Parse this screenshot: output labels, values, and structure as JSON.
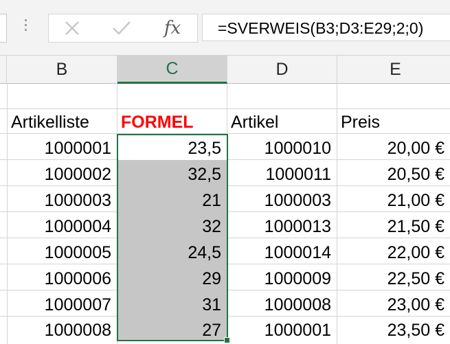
{
  "formula_bar": {
    "cancel_icon": "close-icon",
    "enter_icon": "checkmark-icon",
    "fx_label": "fx",
    "formula": "=SVERWEIS(B3;D3:E29;2;0)"
  },
  "columns": [
    "B",
    "C",
    "D",
    "E"
  ],
  "active_column": "C",
  "header_row": {
    "b": "Artikelliste",
    "c": "FORMEL",
    "d": "Artikel",
    "e": "Preis"
  },
  "rows": [
    {
      "b": "1000001",
      "c": "23,5",
      "d": "1000010",
      "e": "20,00 €"
    },
    {
      "b": "1000002",
      "c": "32,5",
      "d": "1000011",
      "e": "20,50 €"
    },
    {
      "b": "1000003",
      "c": "21",
      "d": "1000003",
      "e": "21,00 €"
    },
    {
      "b": "1000004",
      "c": "32",
      "d": "1000013",
      "e": "21,50 €"
    },
    {
      "b": "1000005",
      "c": "24,5",
      "d": "1000014",
      "e": "22,00 €"
    },
    {
      "b": "1000006",
      "c": "29",
      "d": "1000009",
      "e": "22,50 €"
    },
    {
      "b": "1000007",
      "c": "31",
      "d": "1000008",
      "e": "23,00 €"
    },
    {
      "b": "1000008",
      "c": "27",
      "d": "1000001",
      "e": "23,50 €"
    }
  ],
  "colors": {
    "accent": "#217346",
    "formel_text": "#ff0000",
    "selection_fill": "#c6c6c6"
  }
}
